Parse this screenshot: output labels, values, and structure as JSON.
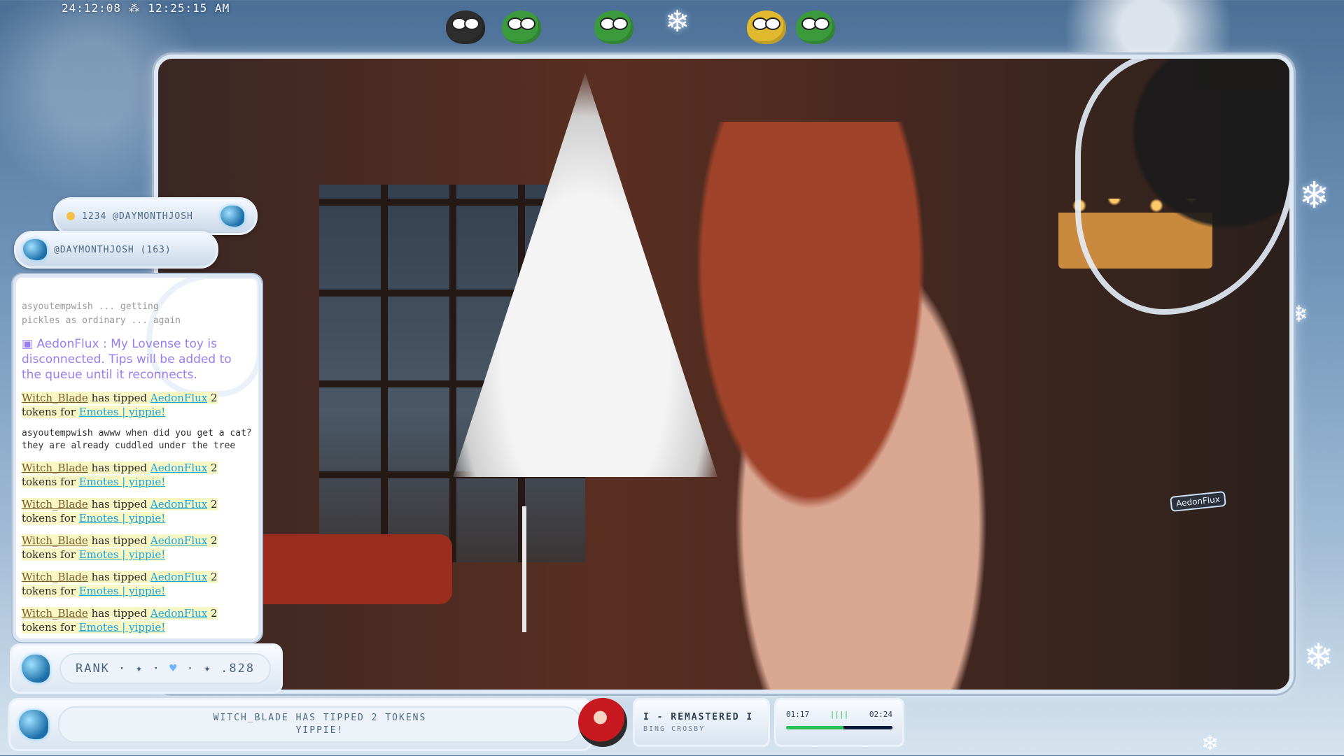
{
  "clock": {
    "text": "24:12:08 ⁂ 12:25:15 AM"
  },
  "tip_pills": {
    "last_tip": "1234 @DAYMONTHJOSH",
    "top_tipper": "@DAYMONTHJOSH (163)"
  },
  "stream": {
    "overlay_tag": "AedonFlux"
  },
  "chat": {
    "faded_line_1": "asyoutempwish  ...  getting",
    "faded_line_2": "pickles as ordinary  ...  again",
    "system_user": "AedonFlux",
    "system_text": " : My Lovense toy is disconnected. Tips will be added to the queue until it reconnects.",
    "tip_verb": " has tipped ",
    "tip_tail": " 2 tokens for ",
    "tip_user": "Witch_Blade",
    "tip_target": "AedonFlux",
    "tip_item": "Emotes | yippie!",
    "msg_user": "asyoutempwish",
    "msg_text": " awww when did you get a cat? they are already cuddled under the tree"
  },
  "rank": {
    "label": "RANK",
    "sep1": "· ✦ ·",
    "heart": "♥",
    "sep2": "· ✦",
    "value": ".828"
  },
  "alert": {
    "line1": "WITCH_BLADE HAS TIPPED 2 TOKENS",
    "line2": "YIPPIE!"
  },
  "music": {
    "title": "I - REMASTERED I",
    "artist": "BING CROSBY",
    "elapsed": "01:17",
    "bars": "||||",
    "total": "02:24",
    "progress_fraction": 0.54
  },
  "colors": {
    "chat_system": "#9a7df2",
    "chat_link": "#1aa4e0",
    "progress": "#2bbf57"
  }
}
